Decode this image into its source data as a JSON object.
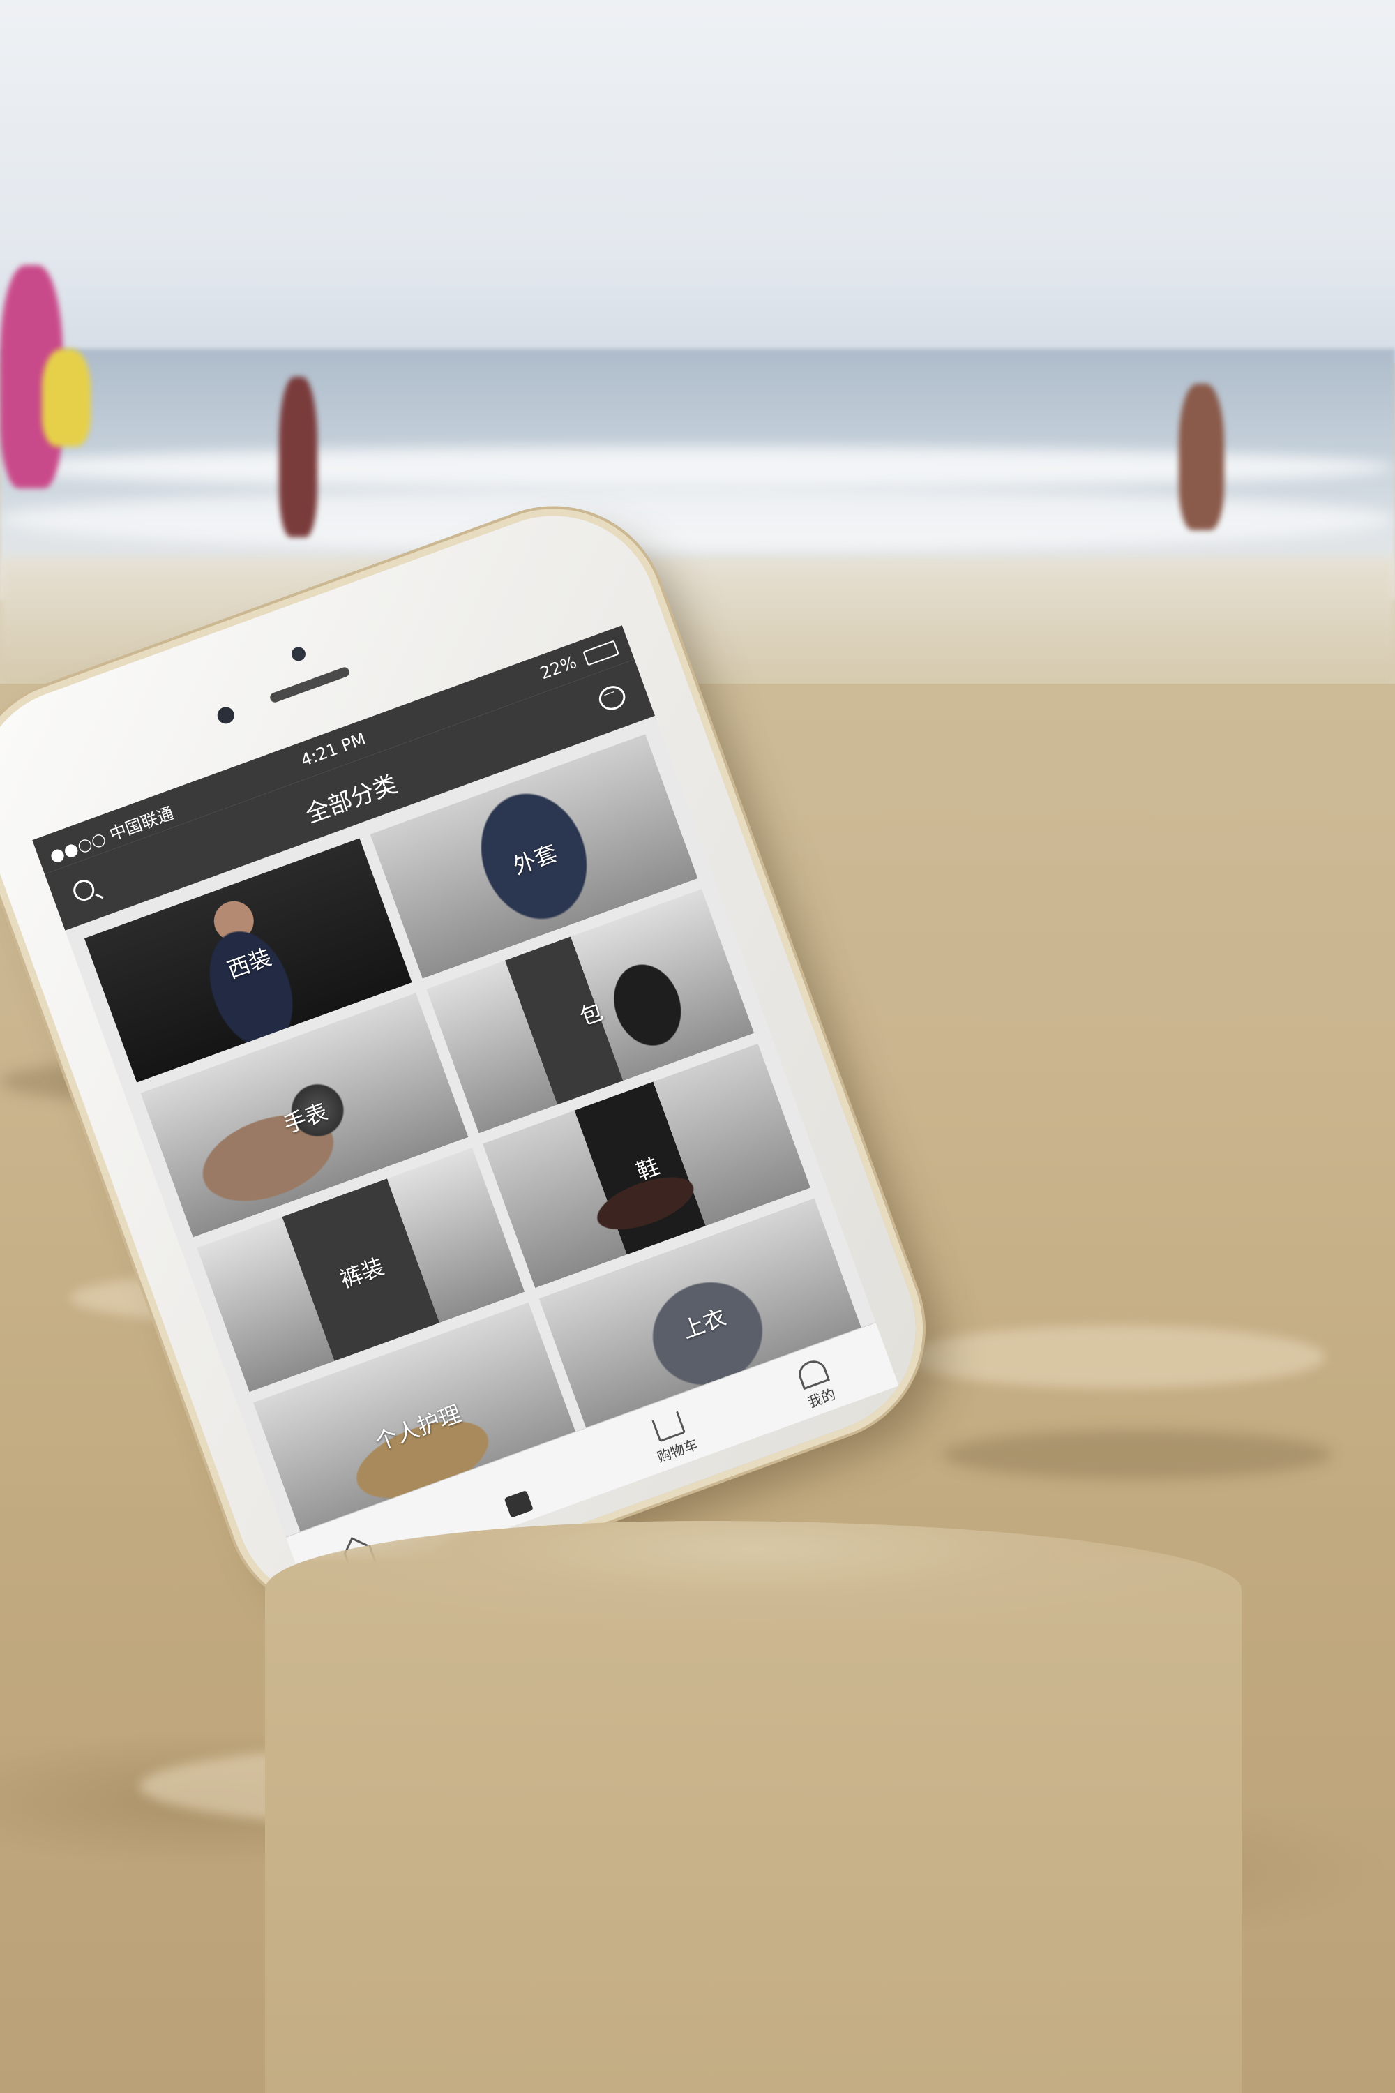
{
  "status": {
    "carrier": "●●○○ 中国联通",
    "time": "4:21 PM",
    "battery": "22%"
  },
  "header": {
    "title": "全部分类"
  },
  "categories": [
    {
      "label": "外套"
    },
    {
      "label": "西装"
    },
    {
      "label": "包"
    },
    {
      "label": "手表"
    },
    {
      "label": "鞋"
    },
    {
      "label": "裤装"
    },
    {
      "label": "上衣"
    },
    {
      "label": "个人护理"
    }
  ],
  "tabs": [
    {
      "label": ""
    },
    {
      "label": ""
    },
    {
      "label": "购物车"
    },
    {
      "label": "我的"
    }
  ]
}
